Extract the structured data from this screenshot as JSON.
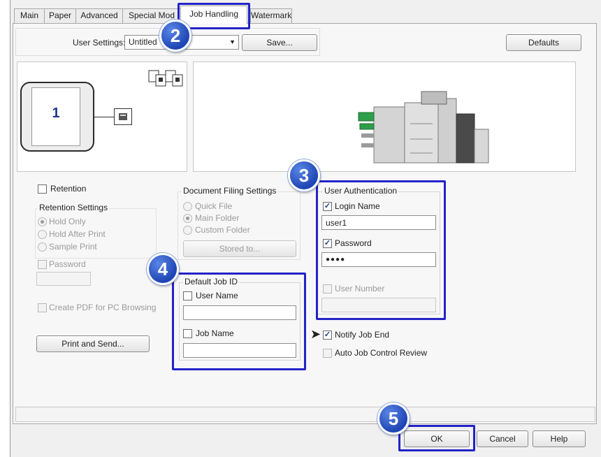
{
  "tabs": [
    {
      "label": "Main"
    },
    {
      "label": "Paper"
    },
    {
      "label": "Advanced"
    },
    {
      "label": "Special Mod"
    },
    {
      "label": "Job Handling"
    },
    {
      "label": "Watermarks"
    }
  ],
  "user_settings": {
    "label": "User Settings:",
    "value": "Untitled",
    "save_label": "Save...",
    "defaults_label": "Defaults"
  },
  "preview": {
    "page_number": "1"
  },
  "retention": {
    "checkbox_label": "Retention",
    "group_title": "Retention Settings",
    "options": [
      "Hold Only",
      "Hold After Print",
      "Sample Print"
    ],
    "password_label": "Password",
    "create_pdf_label": "Create PDF for PC Browsing",
    "print_and_send_label": "Print and Send..."
  },
  "document_filing": {
    "group_title": "Document Filing Settings",
    "options": [
      "Quick File",
      "Main Folder",
      "Custom Folder"
    ],
    "stored_to_label": "Stored to..."
  },
  "default_job_id": {
    "group_title": "Default Job ID",
    "user_name_label": "User Name",
    "user_name_value": "",
    "job_name_label": "Job Name",
    "job_name_value": ""
  },
  "user_authentication": {
    "group_title": "User Authentication",
    "login_name_label": "Login Name",
    "login_name_value": "user1",
    "password_label": "Password",
    "password_value": "●●●●",
    "user_number_label": "User Number"
  },
  "notify_job_end_label": "Notify Job End",
  "auto_job_control_label": "Auto Job Control Review",
  "footer": {
    "ok_label": "OK",
    "cancel_label": "Cancel",
    "help_label": "Help"
  },
  "steps": [
    "2",
    "3",
    "4",
    "5"
  ],
  "colors": {
    "highlight": "#2323c8",
    "step_badge": "#1e45b4",
    "check": "#1a3d8f"
  }
}
